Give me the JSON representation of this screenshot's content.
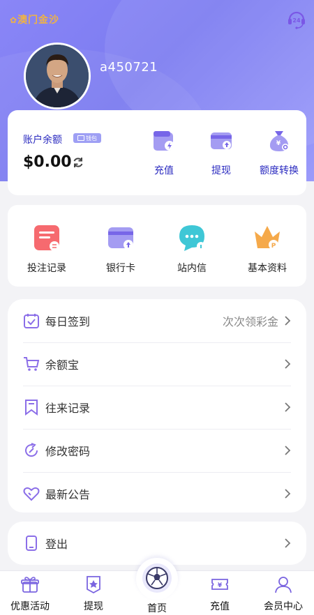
{
  "header": {
    "logo_text": "澳门金沙",
    "username": "a450721"
  },
  "balance": {
    "label": "账户余额",
    "tag": "钱包",
    "amount": "$0.00",
    "actions": [
      {
        "label": "充值",
        "icon": "wallet-lightning-icon"
      },
      {
        "label": "提现",
        "icon": "card-withdraw-icon"
      },
      {
        "label": "额度转换",
        "icon": "money-bag-icon"
      }
    ]
  },
  "quick": [
    {
      "label": "投注记录",
      "icon": "bet-record-icon"
    },
    {
      "label": "银行卡",
      "icon": "bank-card-icon"
    },
    {
      "label": "站内信",
      "icon": "message-icon"
    },
    {
      "label": "基本资料",
      "icon": "crown-icon"
    }
  ],
  "menu": [
    {
      "label": "每日签到",
      "extra": "次次领彩金",
      "icon": "calendar-check-icon"
    },
    {
      "label": "余额宝",
      "extra": "",
      "icon": "cart-icon"
    },
    {
      "label": "往来记录",
      "extra": "",
      "icon": "bookmark-icon"
    },
    {
      "label": "修改密码",
      "extra": "",
      "icon": "refresh-arrow-icon"
    },
    {
      "label": "最新公告",
      "extra": "",
      "icon": "heart-icon"
    }
  ],
  "logout": {
    "label": "登出"
  },
  "tabs": [
    {
      "label": "优惠活动",
      "icon": "gift-icon"
    },
    {
      "label": "提现",
      "icon": "badge-star-icon"
    },
    {
      "label": "首页",
      "icon": "soccer-ball-icon"
    },
    {
      "label": "充值",
      "icon": "yen-ticket-icon"
    },
    {
      "label": "会员中心",
      "icon": "user-icon"
    }
  ],
  "colors": {
    "accent": "#7b7bf0",
    "label_blue": "#2b2bc0",
    "icon_purple": "#8b6ee8"
  }
}
